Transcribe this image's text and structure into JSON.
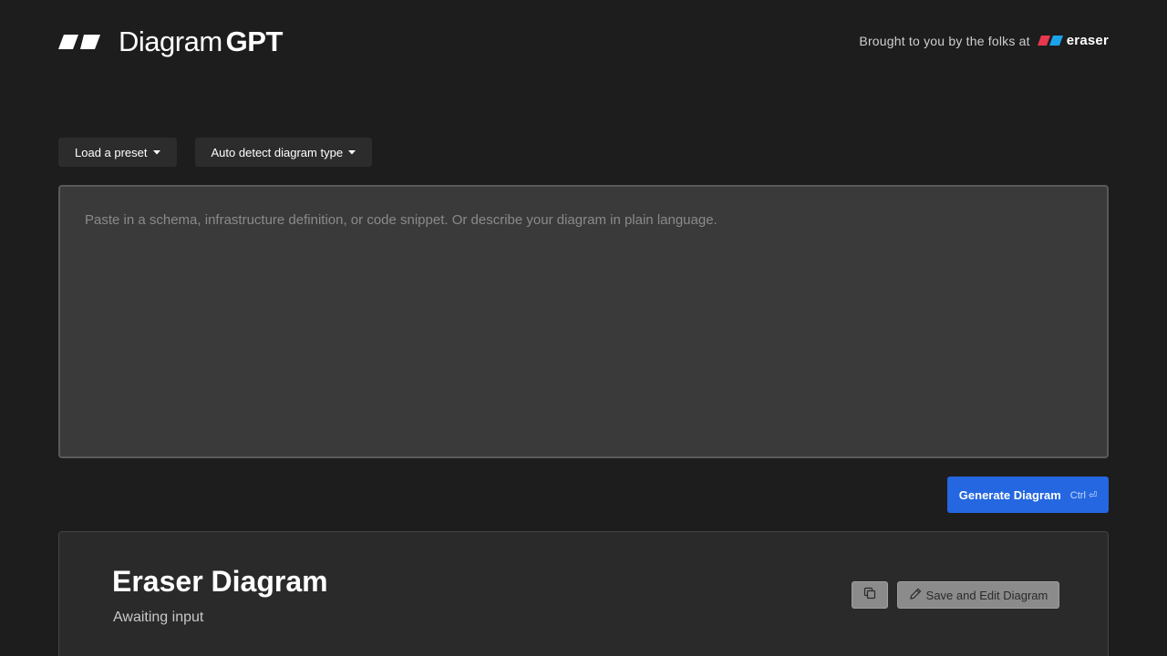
{
  "header": {
    "logo_light": "Diagram",
    "logo_bold": "GPT",
    "credit_text": "Brought to you by the folks at",
    "credit_brand": "eraser"
  },
  "controls": {
    "preset_label": "Load a preset",
    "diagram_type_label": "Auto detect diagram type"
  },
  "input": {
    "placeholder": "Paste in a schema, infrastructure definition, or code snippet. Or describe your diagram in plain language.",
    "value": ""
  },
  "generate": {
    "label": "Generate Diagram",
    "shortcut": "Ctrl ⏎"
  },
  "output": {
    "title": "Eraser Diagram",
    "status": "Awaiting input",
    "save_label": "Save and Edit Diagram"
  },
  "icons": {
    "logo": "diagramgpt-logo-icon",
    "eraser": "eraser-logo-icon",
    "caret": "caret-down-icon",
    "copy": "copy-icon",
    "edit": "pencil-icon"
  },
  "colors": {
    "background": "#1d1d1d",
    "accent": "#2467e0",
    "eraser_red": "#e8374f",
    "eraser_blue": "#1aa3e8"
  }
}
